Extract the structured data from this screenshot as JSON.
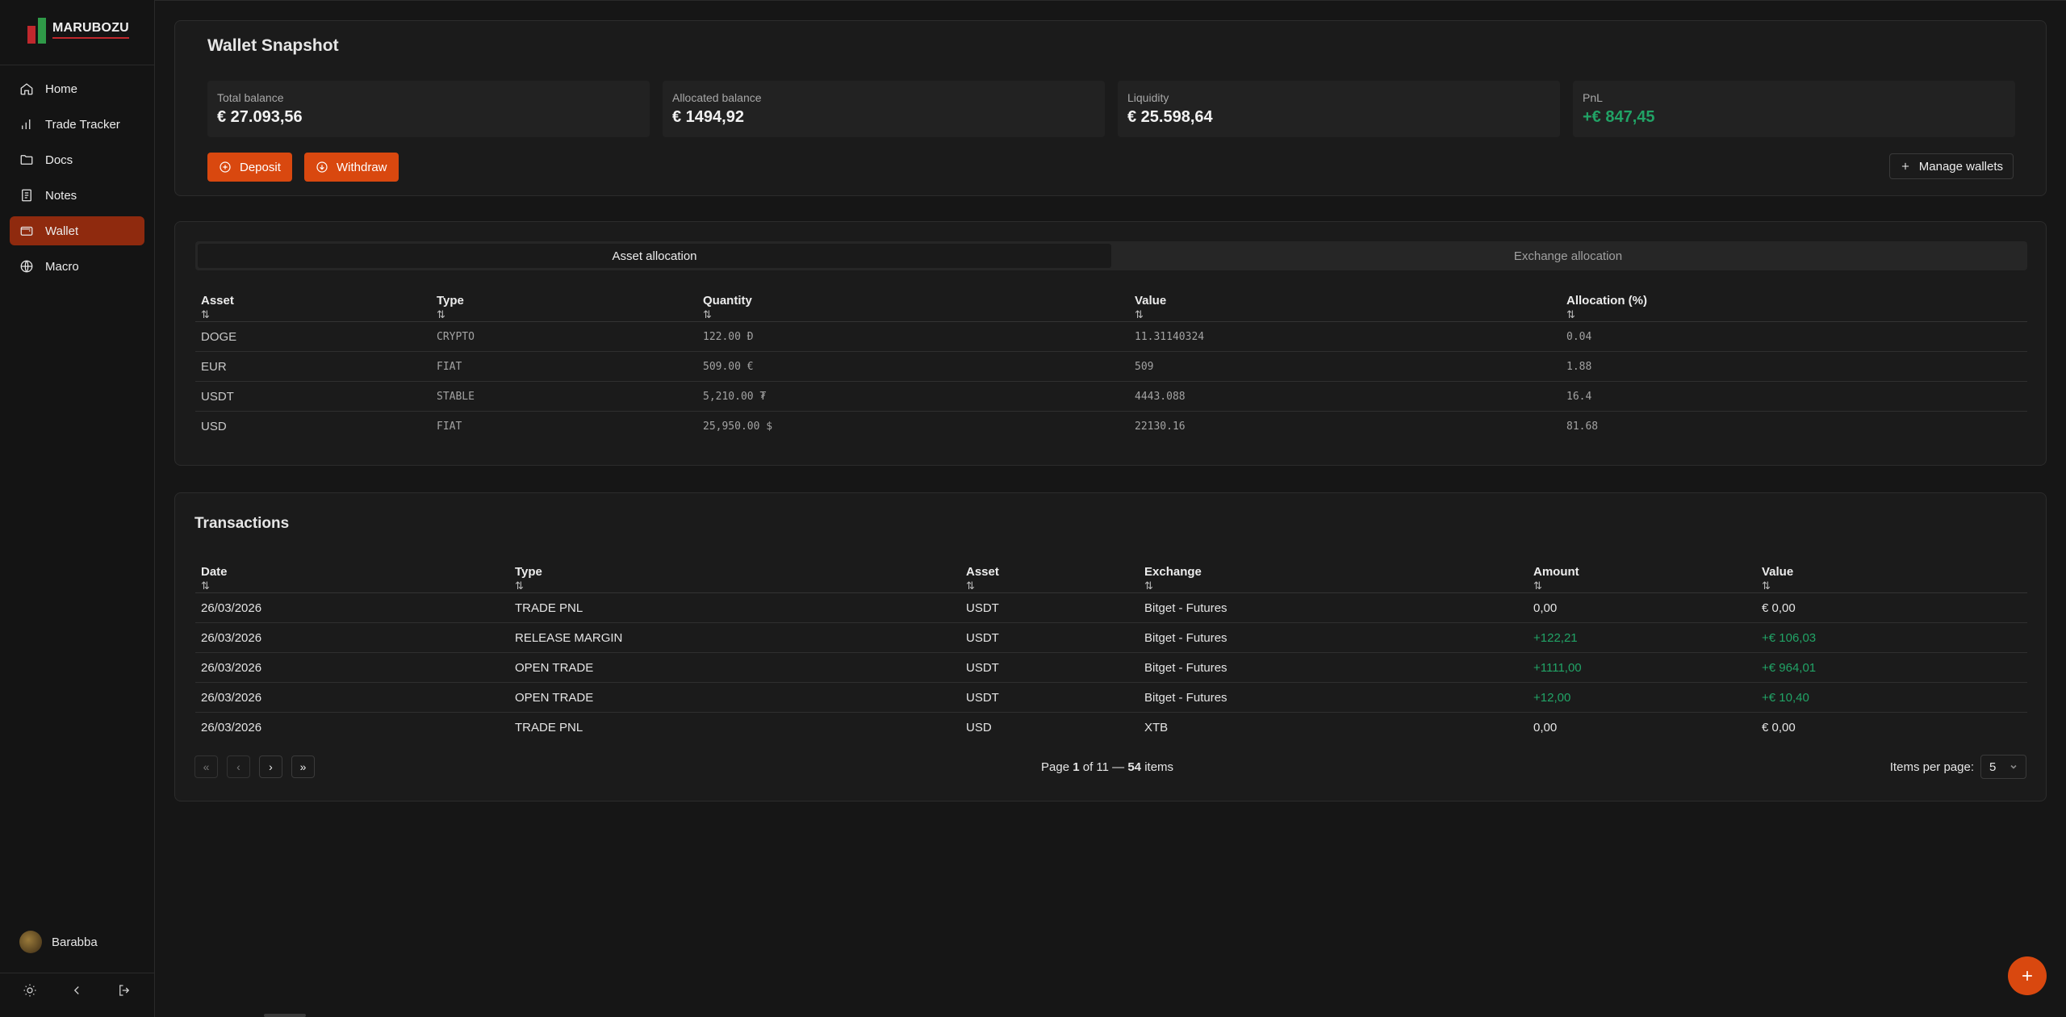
{
  "app": {
    "logo_text": "MARUBOZU",
    "user_name": "Barabba"
  },
  "nav": [
    {
      "label": "Home",
      "icon": "home-icon"
    },
    {
      "label": "Trade Tracker",
      "icon": "bar-chart-icon"
    },
    {
      "label": "Docs",
      "icon": "folder-icon"
    },
    {
      "label": "Notes",
      "icon": "notebook-icon"
    },
    {
      "label": "Wallet",
      "icon": "wallet-icon",
      "active": true
    },
    {
      "label": "Macro",
      "icon": "globe-icon"
    }
  ],
  "snapshot": {
    "title": "Wallet Snapshot",
    "stats": [
      {
        "label": "Total balance",
        "value": "€ 27.093,56"
      },
      {
        "label": "Allocated balance",
        "value": "€ 1494,92"
      },
      {
        "label": "Liquidity",
        "value": "€ 25.598,64"
      },
      {
        "label": "PnL",
        "value": "+€ 847,45",
        "color": "#21a366"
      }
    ],
    "deposit_label": "Deposit",
    "withdraw_label": "Withdraw",
    "manage_label": "Manage wallets"
  },
  "allocation": {
    "tabs": [
      "Asset allocation",
      "Exchange allocation"
    ],
    "active_tab": 0,
    "headers": [
      "Asset",
      "Type",
      "Quantity",
      "Value",
      "Allocation (%)"
    ],
    "sort_glyph": "⇅",
    "rows": [
      [
        "DOGE",
        "CRYPTO",
        "122.00 Đ",
        "11.31140324",
        "0.04"
      ],
      [
        "EUR",
        "FIAT",
        "509.00 €",
        "509",
        "1.88"
      ],
      [
        "USDT",
        "STABLE",
        "5,210.00 ₮",
        "4443.088",
        "16.4"
      ],
      [
        "USD",
        "FIAT",
        "25,950.00 $",
        "22130.16",
        "81.68"
      ]
    ]
  },
  "transactions": {
    "title": "Transactions",
    "headers": [
      "Date",
      "Type",
      "Asset",
      "Exchange",
      "Amount",
      "Value"
    ],
    "rows": [
      [
        "26/03/2026",
        "TRADE PNL",
        "USDT",
        "Bitget - Futures",
        "0,00",
        "€ 0,00"
      ],
      [
        "26/03/2026",
        "RELEASE MARGIN",
        "USDT",
        "Bitget - Futures",
        "+122,21",
        "+€ 106,03"
      ],
      [
        "26/03/2026",
        "OPEN TRADE",
        "USDT",
        "Bitget - Futures",
        "+1111,00",
        "+€ 964,01"
      ],
      [
        "26/03/2026",
        "OPEN TRADE",
        "USDT",
        "Bitget - Futures",
        "+12,00",
        "+€ 10,40"
      ],
      [
        "26/03/2026",
        "TRADE PNL",
        "USD",
        "XTB",
        "0,00",
        "€ 0,00"
      ]
    ],
    "pager": {
      "first": "«",
      "prev": "‹",
      "next": "›",
      "last": "»",
      "page_prefix": "Page",
      "current": "1",
      "of_text": "of 11 —",
      "count": "54",
      "items_suffix": "items",
      "ipp_label": "Items per page:",
      "ipp_value": "5"
    }
  },
  "colors": {
    "accent": "#d9480f",
    "active_nav": "#8f2a0e",
    "positive": "#21a366"
  }
}
